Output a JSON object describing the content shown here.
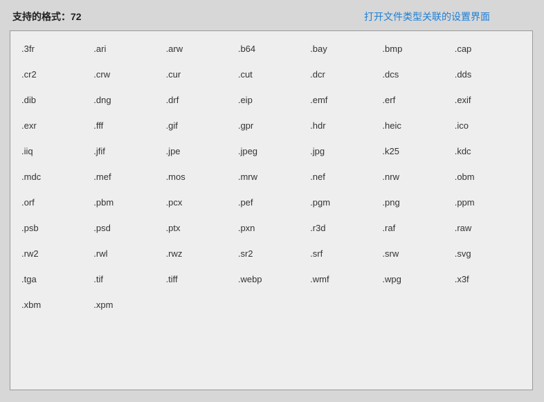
{
  "header": {
    "label_prefix": "支持的格式：",
    "count": "72",
    "link_text": "打开文件类型关联的设置界面"
  },
  "formats": [
    ".3fr",
    ".ari",
    ".arw",
    ".b64",
    ".bay",
    ".bmp",
    ".cap",
    ".cr2",
    ".crw",
    ".cur",
    ".cut",
    ".dcr",
    ".dcs",
    ".dds",
    ".dib",
    ".dng",
    ".drf",
    ".eip",
    ".emf",
    ".erf",
    ".exif",
    ".exr",
    ".fff",
    ".gif",
    ".gpr",
    ".hdr",
    ".heic",
    ".ico",
    ".iiq",
    ".jfif",
    ".jpe",
    ".jpeg",
    ".jpg",
    ".k25",
    ".kdc",
    ".mdc",
    ".mef",
    ".mos",
    ".mrw",
    ".nef",
    ".nrw",
    ".obm",
    ".orf",
    ".pbm",
    ".pcx",
    ".pef",
    ".pgm",
    ".png",
    ".ppm",
    ".psb",
    ".psd",
    ".ptx",
    ".pxn",
    ".r3d",
    ".raf",
    ".raw",
    ".rw2",
    ".rwl",
    ".rwz",
    ".sr2",
    ".srf",
    ".srw",
    ".svg",
    ".tga",
    ".tif",
    ".tiff",
    ".webp",
    ".wmf",
    ".wpg",
    ".x3f",
    ".xbm",
    ".xpm"
  ]
}
